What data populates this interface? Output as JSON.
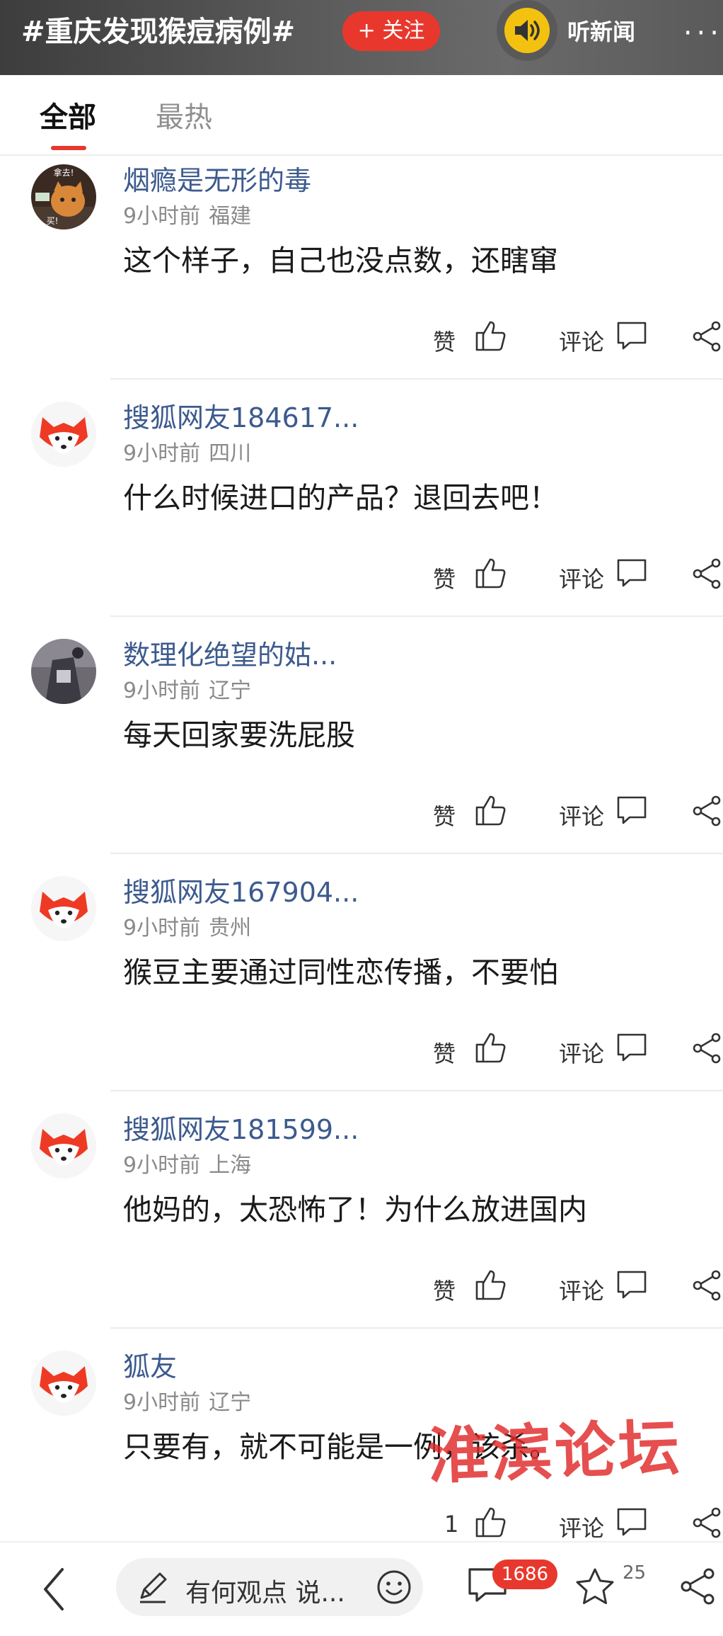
{
  "header": {
    "topic": "#重庆发现猴痘病例#",
    "follow_label": "+ 关注",
    "listen_label": "听新闻",
    "more": "···"
  },
  "tabs": [
    {
      "label": "全部",
      "active": true
    },
    {
      "label": "最热",
      "active": false
    }
  ],
  "actions": {
    "like_label": "赞",
    "comment_label": "评论"
  },
  "comments": [
    {
      "author": "烟瘾是无形的毒",
      "time": "9小时前",
      "location": "福建",
      "text": " 这个样子，自己也没点数，还瞎窜",
      "likes": "",
      "avatar_caption_top": "拿去!",
      "avatar_caption_bottom": "买!"
    },
    {
      "author": "搜狐网友184617...",
      "time": "9小时前",
      "location": "四川",
      "text": "什么时候进口的产品？退回去吧！",
      "likes": ""
    },
    {
      "author": "数理化绝望的姑...",
      "time": "9小时前",
      "location": "辽宁",
      "text": "每天回家要洗屁股",
      "likes": ""
    },
    {
      "author": "搜狐网友167904...",
      "time": "9小时前",
      "location": "贵州",
      "text": "猴豆主要通过同性恋传播，不要怕",
      "likes": ""
    },
    {
      "author": "搜狐网友181599...",
      "time": "9小时前",
      "location": "上海",
      "text": "他妈的，太恐怖了！为什么放进国内",
      "likes": ""
    },
    {
      "author": "狐友",
      "time": "9小时前",
      "location": "辽宁",
      "text": "只要有，就不可能是一例，该杀。",
      "likes": "1"
    }
  ],
  "watermark": "淮滨论坛",
  "bottom_bar": {
    "input_placeholder": "有何观点 说...",
    "comment_count": "1686",
    "favorite_count": "25"
  },
  "colors": {
    "accent": "#e8382d",
    "author": "#3c5a8e",
    "speaker": "#f3c211"
  }
}
